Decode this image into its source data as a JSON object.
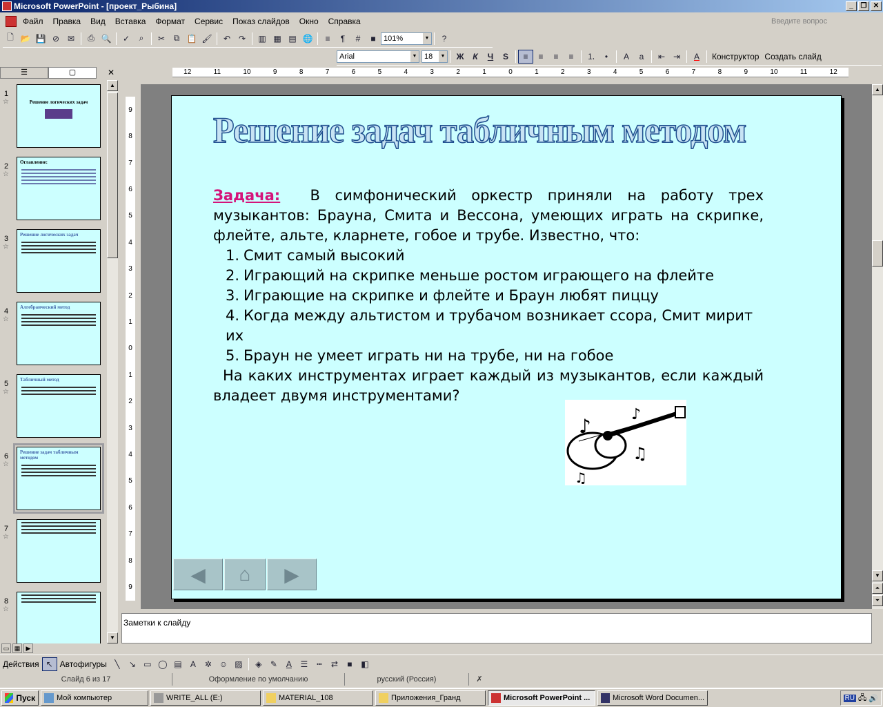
{
  "window": {
    "title": "Microsoft PowerPoint - [проект_Рыбина]"
  },
  "menu": [
    "Файл",
    "Правка",
    "Вид",
    "Вставка",
    "Формат",
    "Сервис",
    "Показ слайдов",
    "Окно",
    "Справка"
  ],
  "ask_placeholder": "Введите вопрос",
  "toolbar": {
    "zoom": "101%",
    "font": "Arial",
    "size": "18",
    "bold": "Ж",
    "italic": "К",
    "underline": "Ч",
    "shadow": "S",
    "designer": "Конструктор",
    "new_slide": "Создать слайд"
  },
  "panel_tabs": [
    "☰",
    "▢"
  ],
  "thumbnails": [
    {
      "num": "1",
      "title": "Решение логических задач"
    },
    {
      "num": "2",
      "title": "Оглавление:"
    },
    {
      "num": "3",
      "title": "Решение логических задач"
    },
    {
      "num": "4",
      "title": "Алгебраический метод"
    },
    {
      "num": "5",
      "title": "Табличный метод"
    },
    {
      "num": "6",
      "title": "Решение задач табличным методом"
    },
    {
      "num": "7",
      "title": ""
    },
    {
      "num": "8",
      "title": ""
    }
  ],
  "ruler": {
    "h": [
      "12",
      "11",
      "10",
      "9",
      "8",
      "7",
      "6",
      "5",
      "4",
      "3",
      "2",
      "1",
      "0",
      "1",
      "2",
      "3",
      "4",
      "5",
      "6",
      "7",
      "8",
      "9",
      "10",
      "11",
      "12"
    ],
    "v": [
      "9",
      "8",
      "7",
      "6",
      "5",
      "4",
      "3",
      "2",
      "1",
      "0",
      "1",
      "2",
      "3",
      "4",
      "5",
      "6",
      "7",
      "8",
      "9"
    ]
  },
  "slide": {
    "title": "Решение задач табличным методом",
    "task_label": "Задача:",
    "intro": "В симфонический оркестр приняли на работу трех музыкантов: Брауна, Смита и Вессона, умеющих играть на скрипке, флейте, альте, кларнете, гобое и трубе. Известно, что:",
    "facts": [
      "Смит самый высокий",
      "Играющий на скрипке меньше ростом играющего на флейте",
      "Играющие на скрипке и флейте и Браун любят пиццу",
      "Когда между альтистом и трубачом возникает ссора, Смит мирит их",
      "Браун не умеет играть ни на трубе, ни на гобое"
    ],
    "question": "На каких инструментах играет каждый из музыкантов, если каждый владеет двумя инструментами?"
  },
  "notes": "Заметки к слайду",
  "draw": {
    "actions": "Действия",
    "autoshapes": "Автофигуры"
  },
  "status": {
    "slide": "Слайд 6 из 17",
    "design": "Оформление по умолчанию",
    "lang": "русский (Россия)"
  },
  "taskbar": {
    "start": "Пуск",
    "items": [
      "Мой компьютер",
      "WRITE_ALL (E:)",
      "MATERIAL_108",
      "Приложения_Гранд",
      "Microsoft PowerPoint ...",
      "Microsoft Word Documen..."
    ],
    "lang": "RU"
  }
}
